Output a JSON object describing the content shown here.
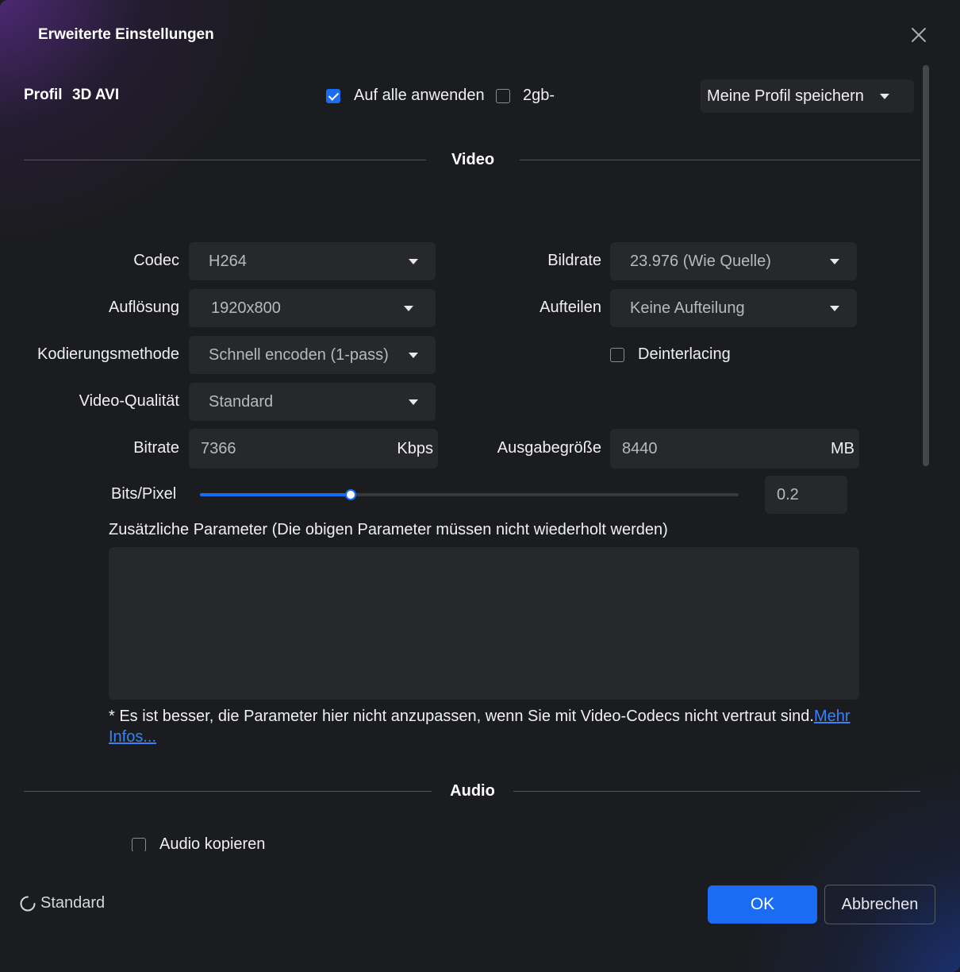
{
  "dialog": {
    "title": "Erweiterte Einstellungen"
  },
  "profile": {
    "label": "Profil",
    "name": "3D AVI",
    "apply_all": {
      "label": "Auf alle anwenden",
      "checked": true
    },
    "split_2gb": {
      "label": "2gb-",
      "checked": false
    },
    "save_profile_label": "Meine Profil speichern"
  },
  "video": {
    "section_title": "Video",
    "codec": {
      "label": "Codec",
      "value": "H264"
    },
    "resolution": {
      "label": "Auflösung",
      "value": "1920x800"
    },
    "encoding_method": {
      "label": "Kodierungsmethode",
      "value": "Schnell encoden (1-pass)"
    },
    "video_quality": {
      "label": "Video-Qualität",
      "value": "Standard"
    },
    "frame_rate": {
      "label": "Bildrate",
      "value": "23.976 (Wie Quelle)"
    },
    "split": {
      "label": "Aufteilen",
      "value": "Keine Aufteilung"
    },
    "deinterlacing": {
      "label": "Deinterlacing",
      "checked": false
    },
    "bitrate": {
      "label": "Bitrate",
      "value": "7366",
      "unit": "Kbps"
    },
    "output_size": {
      "label": "Ausgabegröße",
      "value": "8440",
      "unit": "MB"
    },
    "bits_per_pixel": {
      "label": "Bits/Pixel",
      "value": "0.2",
      "slider_fraction": 0.28
    },
    "extra_params": {
      "label": "Zusätzliche Parameter (Die obigen Parameter müssen nicht wiederholt werden)",
      "value": ""
    },
    "note": "* Es ist besser, die Parameter hier nicht anzupassen, wenn Sie mit Video-Codecs nicht vertraut sind.",
    "more_info_link": "Mehr Infos..."
  },
  "audio": {
    "section_title": "Audio",
    "copy_audio": {
      "label": "Audio kopieren",
      "checked": false
    }
  },
  "footer": {
    "reset_label": "Standard",
    "ok_label": "OK",
    "cancel_label": "Abbrechen"
  },
  "colors": {
    "accent": "#1a6cf5",
    "background": "#1b1c1f",
    "field": "#27282c"
  }
}
